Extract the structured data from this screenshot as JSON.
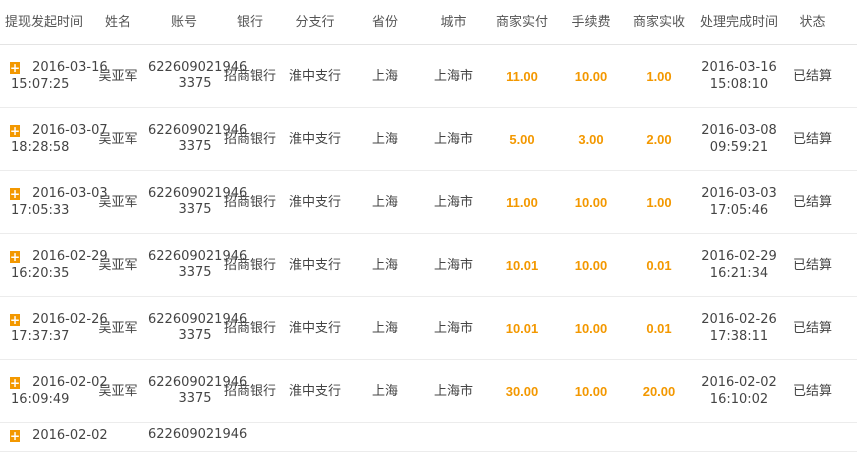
{
  "headers": [
    "提现发起时间",
    "姓名",
    "账号",
    "银行",
    "分支行",
    "省份",
    "城市",
    "商家实付",
    "手续费",
    "商家实收",
    "处理完成时间",
    "状态"
  ],
  "rows": [
    {
      "start_date": "2016-03-16",
      "start_time": "15:07:25",
      "name": "吴亚军",
      "acct1": "622609021946",
      "acct2": "3375",
      "bank": "招商银行",
      "branch": "淮中支行",
      "province": "上海",
      "city": "上海市",
      "paid": "11.00",
      "fee": "10.00",
      "received": "1.00",
      "done_date": "2016-03-16",
      "done_time": "15:08:10",
      "status": "已结算"
    },
    {
      "start_date": "2016-03-07",
      "start_time": "18:28:58",
      "name": "吴亚军",
      "acct1": "622609021946",
      "acct2": "3375",
      "bank": "招商银行",
      "branch": "淮中支行",
      "province": "上海",
      "city": "上海市",
      "paid": "5.00",
      "fee": "3.00",
      "received": "2.00",
      "done_date": "2016-03-08",
      "done_time": "09:59:21",
      "status": "已结算"
    },
    {
      "start_date": "2016-03-03",
      "start_time": "17:05:33",
      "name": "吴亚军",
      "acct1": "622609021946",
      "acct2": "3375",
      "bank": "招商银行",
      "branch": "淮中支行",
      "province": "上海",
      "city": "上海市",
      "paid": "11.00",
      "fee": "10.00",
      "received": "1.00",
      "done_date": "2016-03-03",
      "done_time": "17:05:46",
      "status": "已结算"
    },
    {
      "start_date": "2016-02-29",
      "start_time": "16:20:35",
      "name": "吴亚军",
      "acct1": "622609021946",
      "acct2": "3375",
      "bank": "招商银行",
      "branch": "淮中支行",
      "province": "上海",
      "city": "上海市",
      "paid": "10.01",
      "fee": "10.00",
      "received": "0.01",
      "done_date": "2016-02-29",
      "done_time": "16:21:34",
      "status": "已结算"
    },
    {
      "start_date": "2016-02-26",
      "start_time": "17:37:37",
      "name": "吴亚军",
      "acct1": "622609021946",
      "acct2": "3375",
      "bank": "招商银行",
      "branch": "淮中支行",
      "province": "上海",
      "city": "上海市",
      "paid": "10.01",
      "fee": "10.00",
      "received": "0.01",
      "done_date": "2016-02-26",
      "done_time": "17:38:11",
      "status": "已结算"
    },
    {
      "start_date": "2016-02-02",
      "start_time": "16:09:49",
      "name": "吴亚军",
      "acct1": "622609021946",
      "acct2": "3375",
      "bank": "招商银行",
      "branch": "淮中支行",
      "province": "上海",
      "city": "上海市",
      "paid": "30.00",
      "fee": "10.00",
      "received": "20.00",
      "done_date": "2016-02-02",
      "done_time": "16:10:02",
      "status": "已结算"
    }
  ],
  "partial_row": {
    "start_date": "2016-02-02",
    "acct1": "622609021946"
  },
  "expand_glyph": "+",
  "colors": {
    "accent": "#f39800",
    "border": "#ececec",
    "text": "#444444"
  }
}
